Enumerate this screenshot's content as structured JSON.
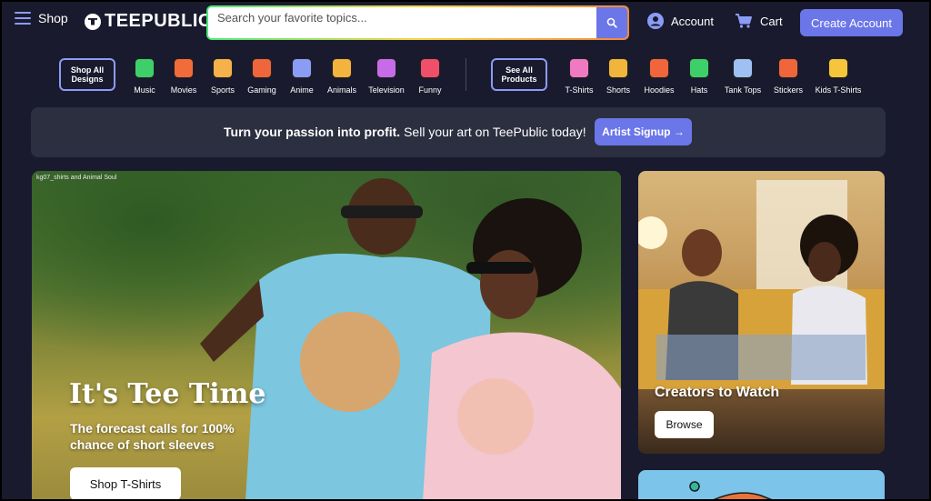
{
  "header": {
    "menu_label": "Shop",
    "logo_text": "TEEPUBLIC",
    "search_placeholder": "Search your favorite topics...",
    "account_label": "Account",
    "cart_label": "Cart",
    "create_account_label": "Create Account"
  },
  "nav": {
    "all_designs_label": "Shop All Designs",
    "design_categories": [
      {
        "label": "Music",
        "icon": "boombox-icon",
        "color": "#3ecf6a"
      },
      {
        "label": "Movies",
        "icon": "clapperboard-icon",
        "color": "#f26b3a"
      },
      {
        "label": "Sports",
        "icon": "baseball-bat-icon",
        "color": "#f5b14a"
      },
      {
        "label": "Gaming",
        "icon": "gamepad-icon",
        "color": "#f0653c"
      },
      {
        "label": "Anime",
        "icon": "anime-face-icon",
        "color": "#8b9cf7"
      },
      {
        "label": "Animals",
        "icon": "cat-icon",
        "color": "#f3b33d"
      },
      {
        "label": "Television",
        "icon": "tv-icon",
        "color": "#c86be8"
      },
      {
        "label": "Funny",
        "icon": "laughing-face-icon",
        "color": "#f04f6a"
      }
    ],
    "all_products_label": "See All Products",
    "product_categories": [
      {
        "label": "T-Shirts",
        "icon": "tshirt-icon",
        "color": "#f07ac2"
      },
      {
        "label": "Shorts",
        "icon": "shorts-icon",
        "color": "#f2b53c"
      },
      {
        "label": "Hoodies",
        "icon": "hoodie-icon",
        "color": "#f0653c"
      },
      {
        "label": "Hats",
        "icon": "cap-icon",
        "color": "#3ecf6a"
      },
      {
        "label": "Tank Tops",
        "icon": "tank-top-icon",
        "color": "#9ec0f2"
      },
      {
        "label": "Stickers",
        "icon": "sticker-icon",
        "color": "#f0653c"
      },
      {
        "label": "Kids T-Shirts",
        "icon": "kids-tshirt-icon",
        "color": "#f5c63c"
      }
    ]
  },
  "banner": {
    "bold_text": "Turn your passion into profit.",
    "text": "Sell your art on TeePublic today!",
    "button_label": "Artist Signup →"
  },
  "hero": {
    "credit": "kg07_shirts and Animal Soul",
    "title": "It's Tee Time",
    "subtitle": "The forecast calls for 100% chance of short sleeves",
    "button_label": "Shop T-Shirts"
  },
  "creators": {
    "title": "Creators to Watch",
    "button_label": "Browse"
  },
  "colors": {
    "background": "#1a1a2e",
    "accent": "#6b76e8",
    "banner_bg": "#2c2f40"
  }
}
